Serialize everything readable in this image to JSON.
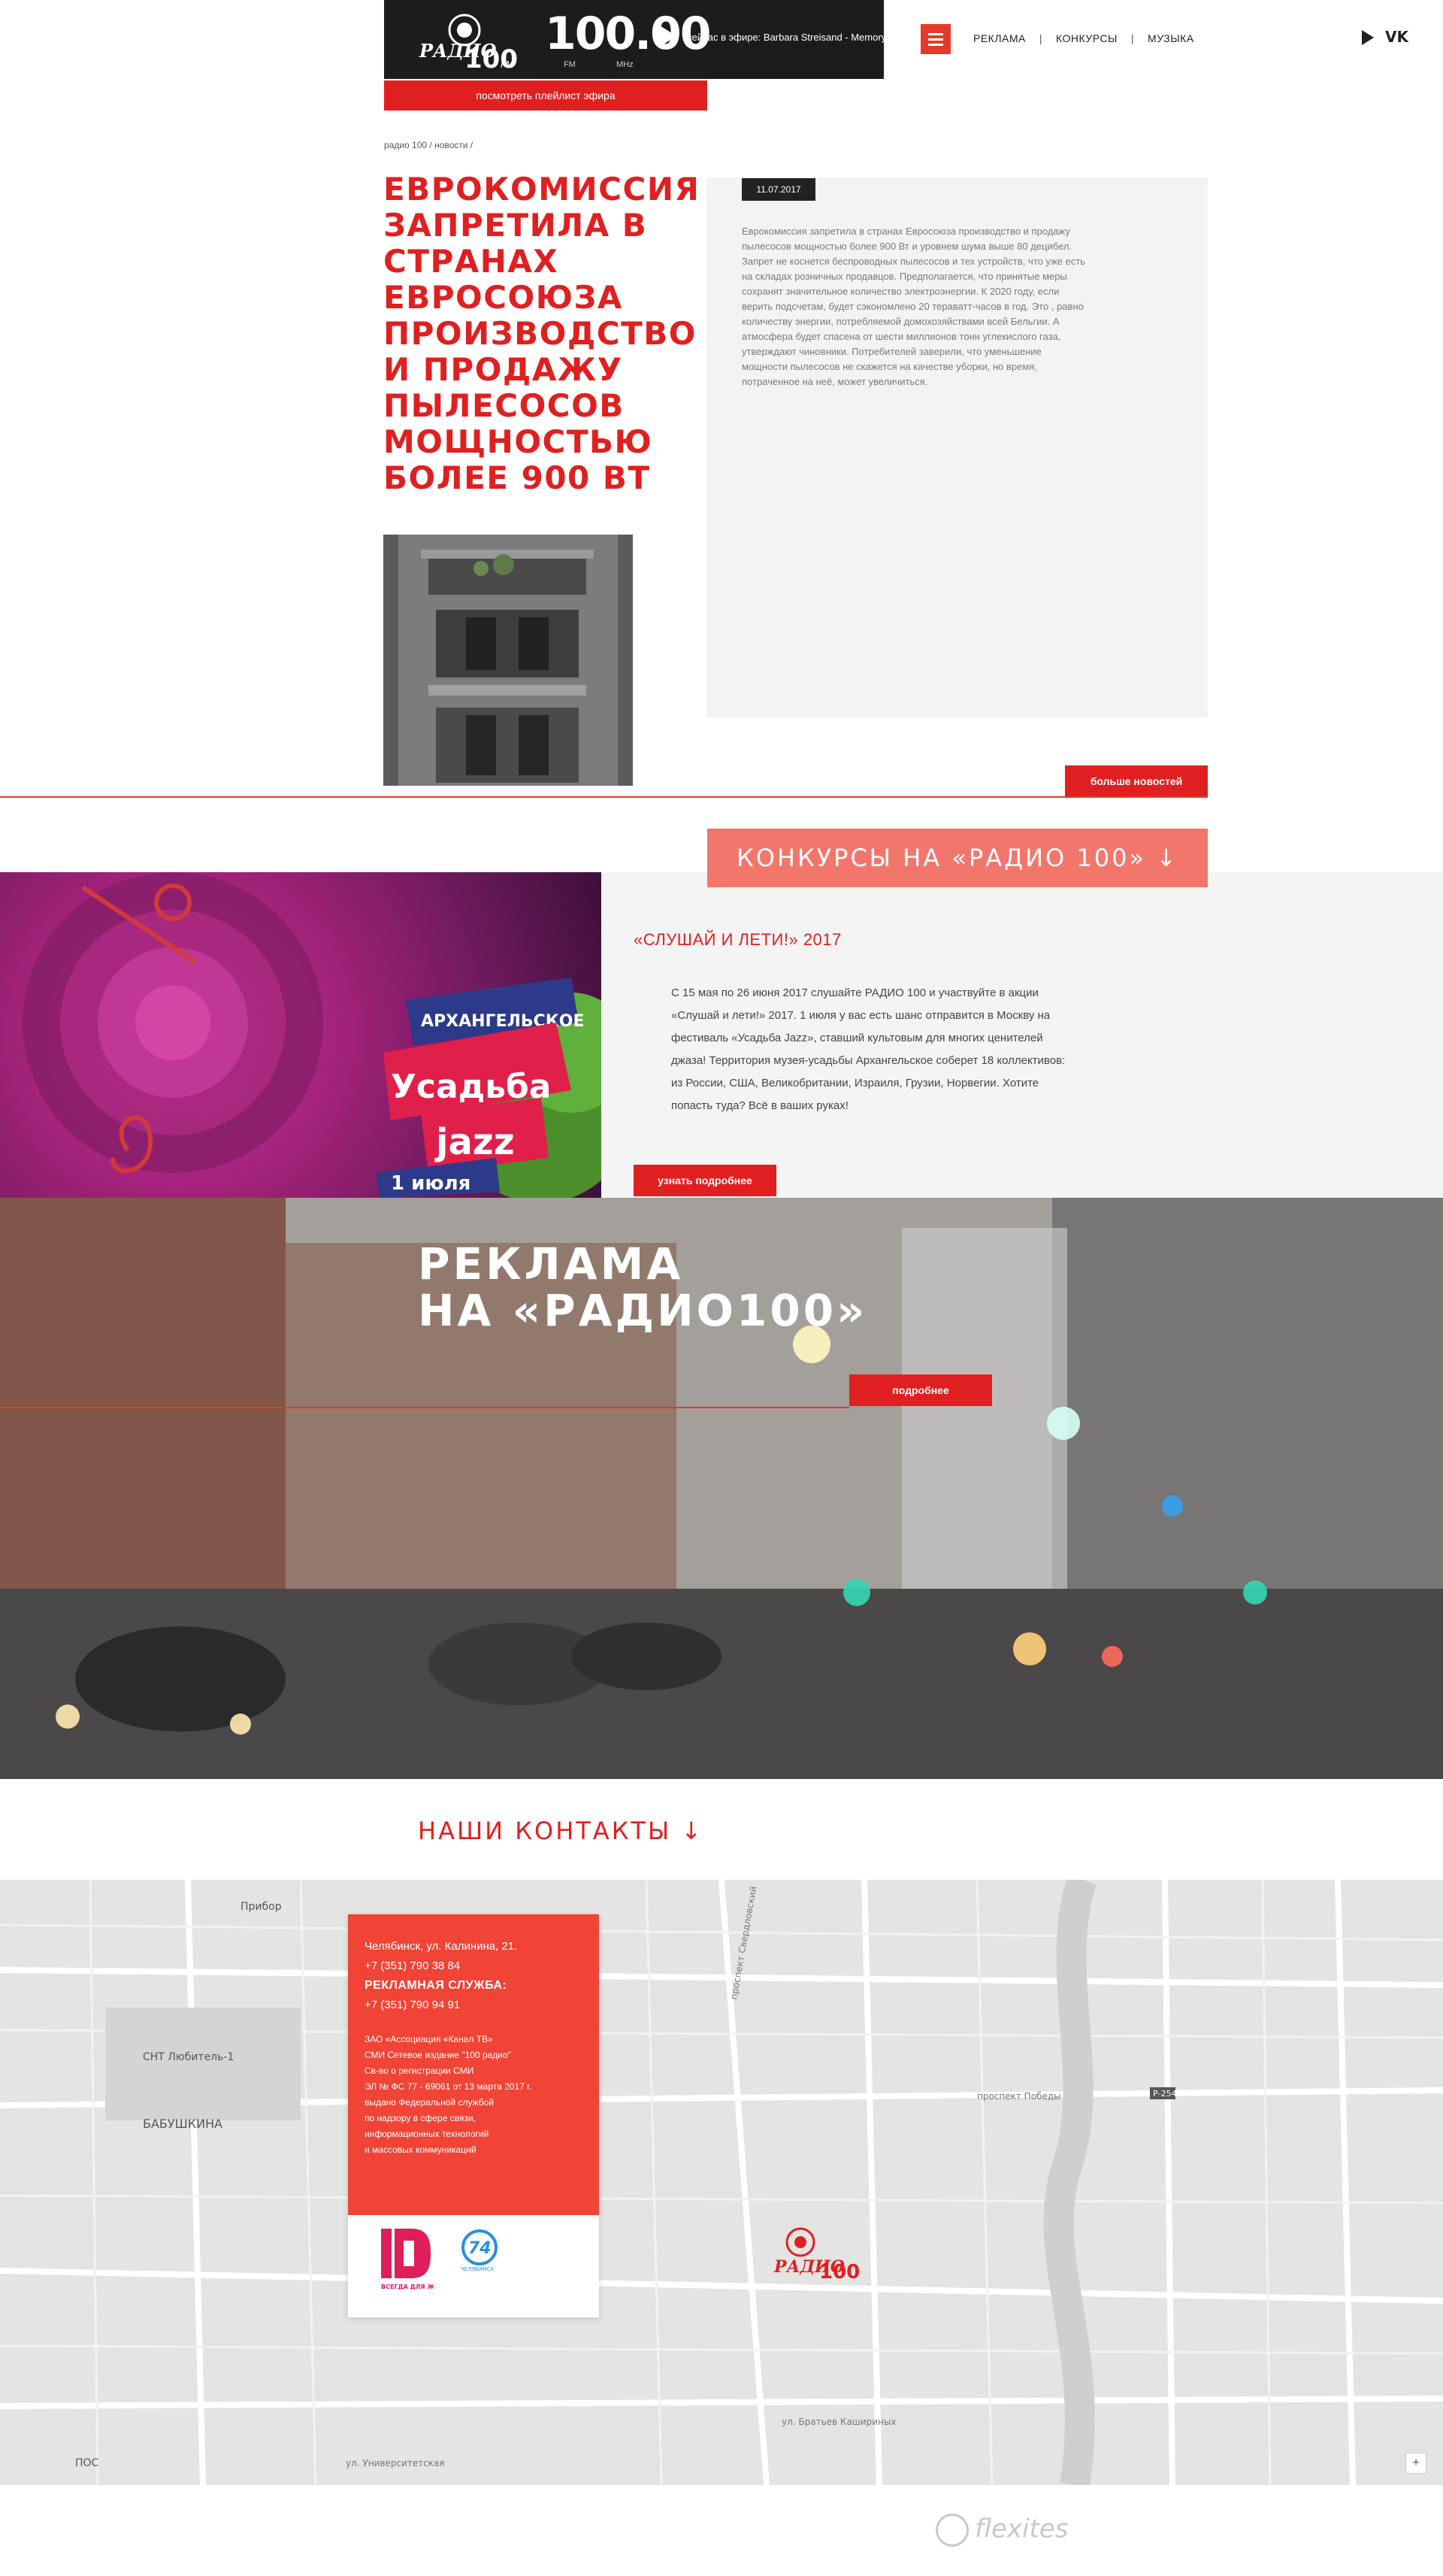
{
  "header": {
    "freq": "100.00",
    "fm": "FM",
    "mhz": "MHz",
    "now_playing": "сейчас в эфире: Barbara Streisand - Memory",
    "playlist_btn": "посмотреть плейлист эфира",
    "nav": [
      "РЕКЛАМА",
      "КОНКУРСЫ",
      "МУЗЫКА"
    ],
    "nav_sep": "|",
    "vk": "VK"
  },
  "breadcrumb": "радио 100 / новости /",
  "news": {
    "title": "Еврокомиссия запретила в странах Евросоюза производство и продажу пылесосов мощностью более 900 Вт",
    "date": "11.07.2017",
    "text": "Еврокомиссия запретила в странах Евросоюза производство и продажу пылесосов мощностью более 900 Вт и уровнем шума выше 80 децибел. Запрет не коснется беспроводных пылесосов и тех устройств, что уже есть на складах розничных продавцов. Предполагается, что принятые меры сохранят значительное количество электроэнергии. К 2020 году, если верить подсчетам, будет сэкономлено 20 тераватт-часов в год. Это , равно количеству энергии, потребляемой домохозяйствами всей Бельгии. А атмосфера будет спасена от шести миллионов тонн углекислого газа, утверждают чиновники. Потребителей заверили, что уменьшение мощности пылесосов не скажется на качестве уборки, но время, потраченное на неё, может увеличиться.",
    "more_btn": "больше новостей"
  },
  "contests": {
    "heading": "КОНКУРСЫ НА «РАДИО 100» ↓",
    "poster": {
      "line1": "АРХАНГЕЛЬСКОЕ",
      "line2": "Усадьба",
      "line3": "jazz",
      "line4": "1 июля"
    },
    "title": "«СЛУШАЙ И ЛЕТИ!»  2017",
    "text": "С 15 мая по 26 июня 2017 слушайте РАДИО 100 и участвуйте в акции «Слушай и лети!» 2017. 1 июля у вас есть шанс отправится в Москву на фестиваль «Усадьба Jazz», ставший культовым для многих ценителей джаза! Территория музея-усадьбы Архангельское соберет 18 коллективов: из России, США, Великобритании, Израиля, Грузии, Норвегии.  Хотите попасть туда? Всё в ваших руках!",
    "btn": "узнать подробнее"
  },
  "ads": {
    "title_line1": "РЕКЛАМА",
    "title_line2": "НА «РАДИО100»",
    "btn": "подробнее"
  },
  "contacts": {
    "heading": "НАШИ КОНТАКТЫ ↓",
    "address": "Челябинск, ул. Калинина, 21.",
    "phone1": "+7 (351) 790 38 84",
    "ad_service": "РЕКЛАМНАЯ СЛУЖБА:",
    "phone2": "+7 (351) 790 94 91",
    "legal": [
      "ЗАО «Ассоциация «Канал ТВ»",
      "СМИ Сетевое издание \"100 радио\"",
      "Св-во о регистрации СМИ",
      "ЭЛ № ФС 77 - 69061 от 13 марта 2017 г.",
      "выдано Федеральной службой",
      "по надзору в сфере связи,",
      "информационных технологий",
      "и массовых коммуникаций"
    ],
    "brand_d_caption": "ВСЕГДА ДЛЯ ЖЕНЩИН",
    "brand_74_caption": "ЧЕЛЯБИНСК"
  },
  "map": {
    "labels": [
      "Прибор",
      "СНТ Любитель-1",
      "БАБУШКИНА",
      "проспект Победы",
      "ул. Братьев Кашириных",
      "ул. Университетская",
      "ПОС",
      "проспект Свердловский",
      "Р-254"
    ],
    "zoom": "+"
  },
  "footer": {
    "brand": "flexites"
  },
  "colors": {
    "accent": "#e02020",
    "accent_soft": "#f3766c",
    "dark": "#1c1c1c",
    "panel": "#f3f3f3"
  }
}
